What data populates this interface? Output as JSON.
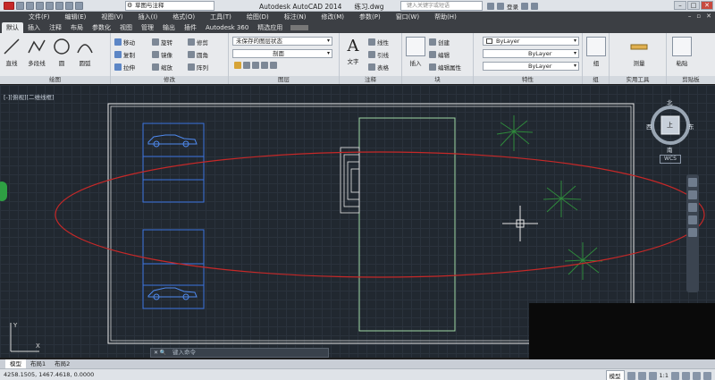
{
  "titlebar": {
    "workspace": "草图与注释",
    "app_title": "Autodesk AutoCAD 2014",
    "file_name": "练习.dwg",
    "search_placeholder": "键入关键字或短语",
    "user_label": "登录"
  },
  "menubar": {
    "items": [
      "文件(F)",
      "编辑(E)",
      "视图(V)",
      "插入(I)",
      "格式(O)",
      "工具(T)",
      "绘图(D)",
      "标注(N)",
      "修改(M)",
      "参数(P)",
      "窗口(W)",
      "帮助(H)"
    ]
  },
  "ribbon_tabs": [
    "默认",
    "插入",
    "注释",
    "布局",
    "参数化",
    "视图",
    "管理",
    "输出",
    "插件",
    "Autodesk 360",
    "精选应用"
  ],
  "ribbon": {
    "draw": {
      "title": "绘图",
      "tools": [
        "直线",
        "多段线",
        "圆",
        "圆弧"
      ]
    },
    "modify": {
      "title": "修改",
      "tools": [
        "移动",
        "旋转",
        "修剪",
        "复制",
        "镜像",
        "圆角",
        "拉伸",
        "缩放",
        "阵列"
      ]
    },
    "layers": {
      "title": "图层",
      "state": "未保存的图层状态",
      "current_layer": "剖面"
    },
    "annotation": {
      "title": "注释",
      "text_label": "文字",
      "tools": [
        "线性",
        "引线",
        "表格"
      ]
    },
    "block": {
      "title": "块",
      "insert_label": "插入",
      "tools": [
        "创建",
        "编辑",
        "编辑属性"
      ]
    },
    "properties": {
      "title": "特性",
      "color": "ByLayer",
      "linetype": "ByLayer",
      "lineweight": "ByLayer"
    },
    "groups": {
      "title": "组",
      "label": "组"
    },
    "utilities": {
      "title": "实用工具",
      "label": "测量"
    },
    "clipboard": {
      "title": "剪贴板",
      "label": "粘贴"
    }
  },
  "viewport": {
    "label": "[-][俯视][二维线框]",
    "viewcube": {
      "north": "北",
      "south": "南",
      "east": "东",
      "west": "西",
      "face": "上",
      "wcs": "WCS"
    },
    "colors": {
      "border": "#e8e8e8",
      "building": "#9fd8a3",
      "cars": "#3b73e0",
      "ellipse": "#c62828",
      "plants": "#2f8a3c",
      "crosshair": "#e6e6e6"
    }
  },
  "command_line": {
    "placeholder": "键入命令"
  },
  "layout_tabs": [
    "模型",
    "布局1",
    "布局2"
  ],
  "status": {
    "coords": "4258.1505, 1467.4618, 0.0000",
    "mode": "模型",
    "scale": "1:1"
  }
}
